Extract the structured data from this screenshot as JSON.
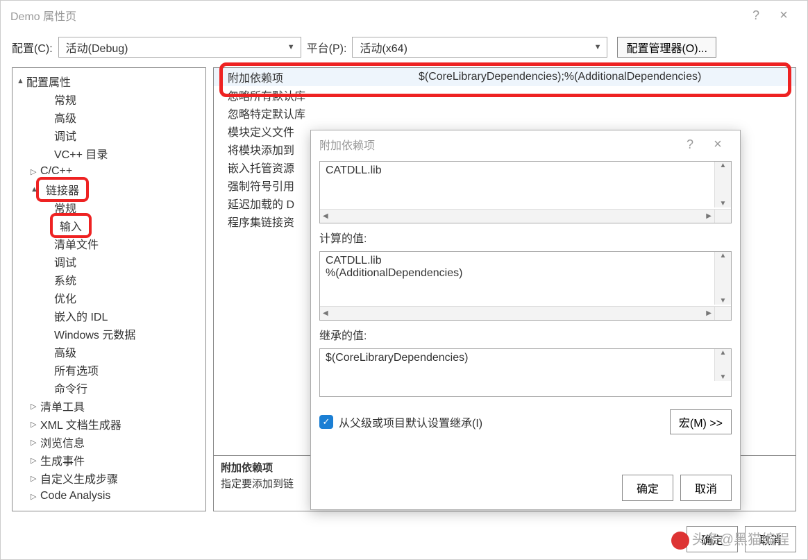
{
  "window": {
    "title": "Demo 属性页"
  },
  "top": {
    "config_label": "配置(C):",
    "config_value": "活动(Debug)",
    "platform_label": "平台(P):",
    "platform_value": "活动(x64)",
    "cfg_mgr": "配置管理器(O)..."
  },
  "tree": {
    "root": "配置属性",
    "items_lvl2a": [
      "常规",
      "高级",
      "调试",
      "VC++ 目录",
      "C/C++"
    ],
    "linker": "链接器",
    "linker_children": [
      "常规",
      "输入",
      "清单文件",
      "调试",
      "系统",
      "优化",
      "嵌入的 IDL",
      "Windows 元数据",
      "高级",
      "所有选项",
      "命令行"
    ],
    "items_lvl2b": [
      "清单工具",
      "XML 文档生成器",
      "浏览信息",
      "生成事件",
      "自定义生成步骤",
      "Code Analysis"
    ]
  },
  "grid": {
    "rows": [
      {
        "label": "附加依赖项",
        "value": "$(CoreLibraryDependencies);%(AdditionalDependencies)"
      },
      {
        "label": "忽略所有默认库",
        "value": ""
      },
      {
        "label": "忽略特定默认库",
        "value": ""
      },
      {
        "label": "模块定义文件",
        "value": ""
      },
      {
        "label": "将模块添加到",
        "value": ""
      },
      {
        "label": "嵌入托管资源",
        "value": ""
      },
      {
        "label": "强制符号引用",
        "value": ""
      },
      {
        "label": "延迟加载的 D",
        "value": ""
      },
      {
        "label": "程序集链接资",
        "value": ""
      }
    ],
    "desc_title": "附加依赖项",
    "desc_text": "指定要添加到链"
  },
  "popup": {
    "title": "附加依赖项",
    "box1": "CATDLL.lib",
    "calc_label": "计算的值:",
    "box2": "CATDLL.lib\n%(AdditionalDependencies)",
    "inherit_label": "继承的值:",
    "box3": "$(CoreLibraryDependencies)",
    "inherit_checkbox": "从父级或项目默认设置继承(I)",
    "macro_btn": "宏(M) >>",
    "ok": "确定",
    "cancel": "取消"
  },
  "footer": {
    "ok": "确定",
    "cancel": "取消"
  },
  "watermark": "头条@黑猫编程"
}
